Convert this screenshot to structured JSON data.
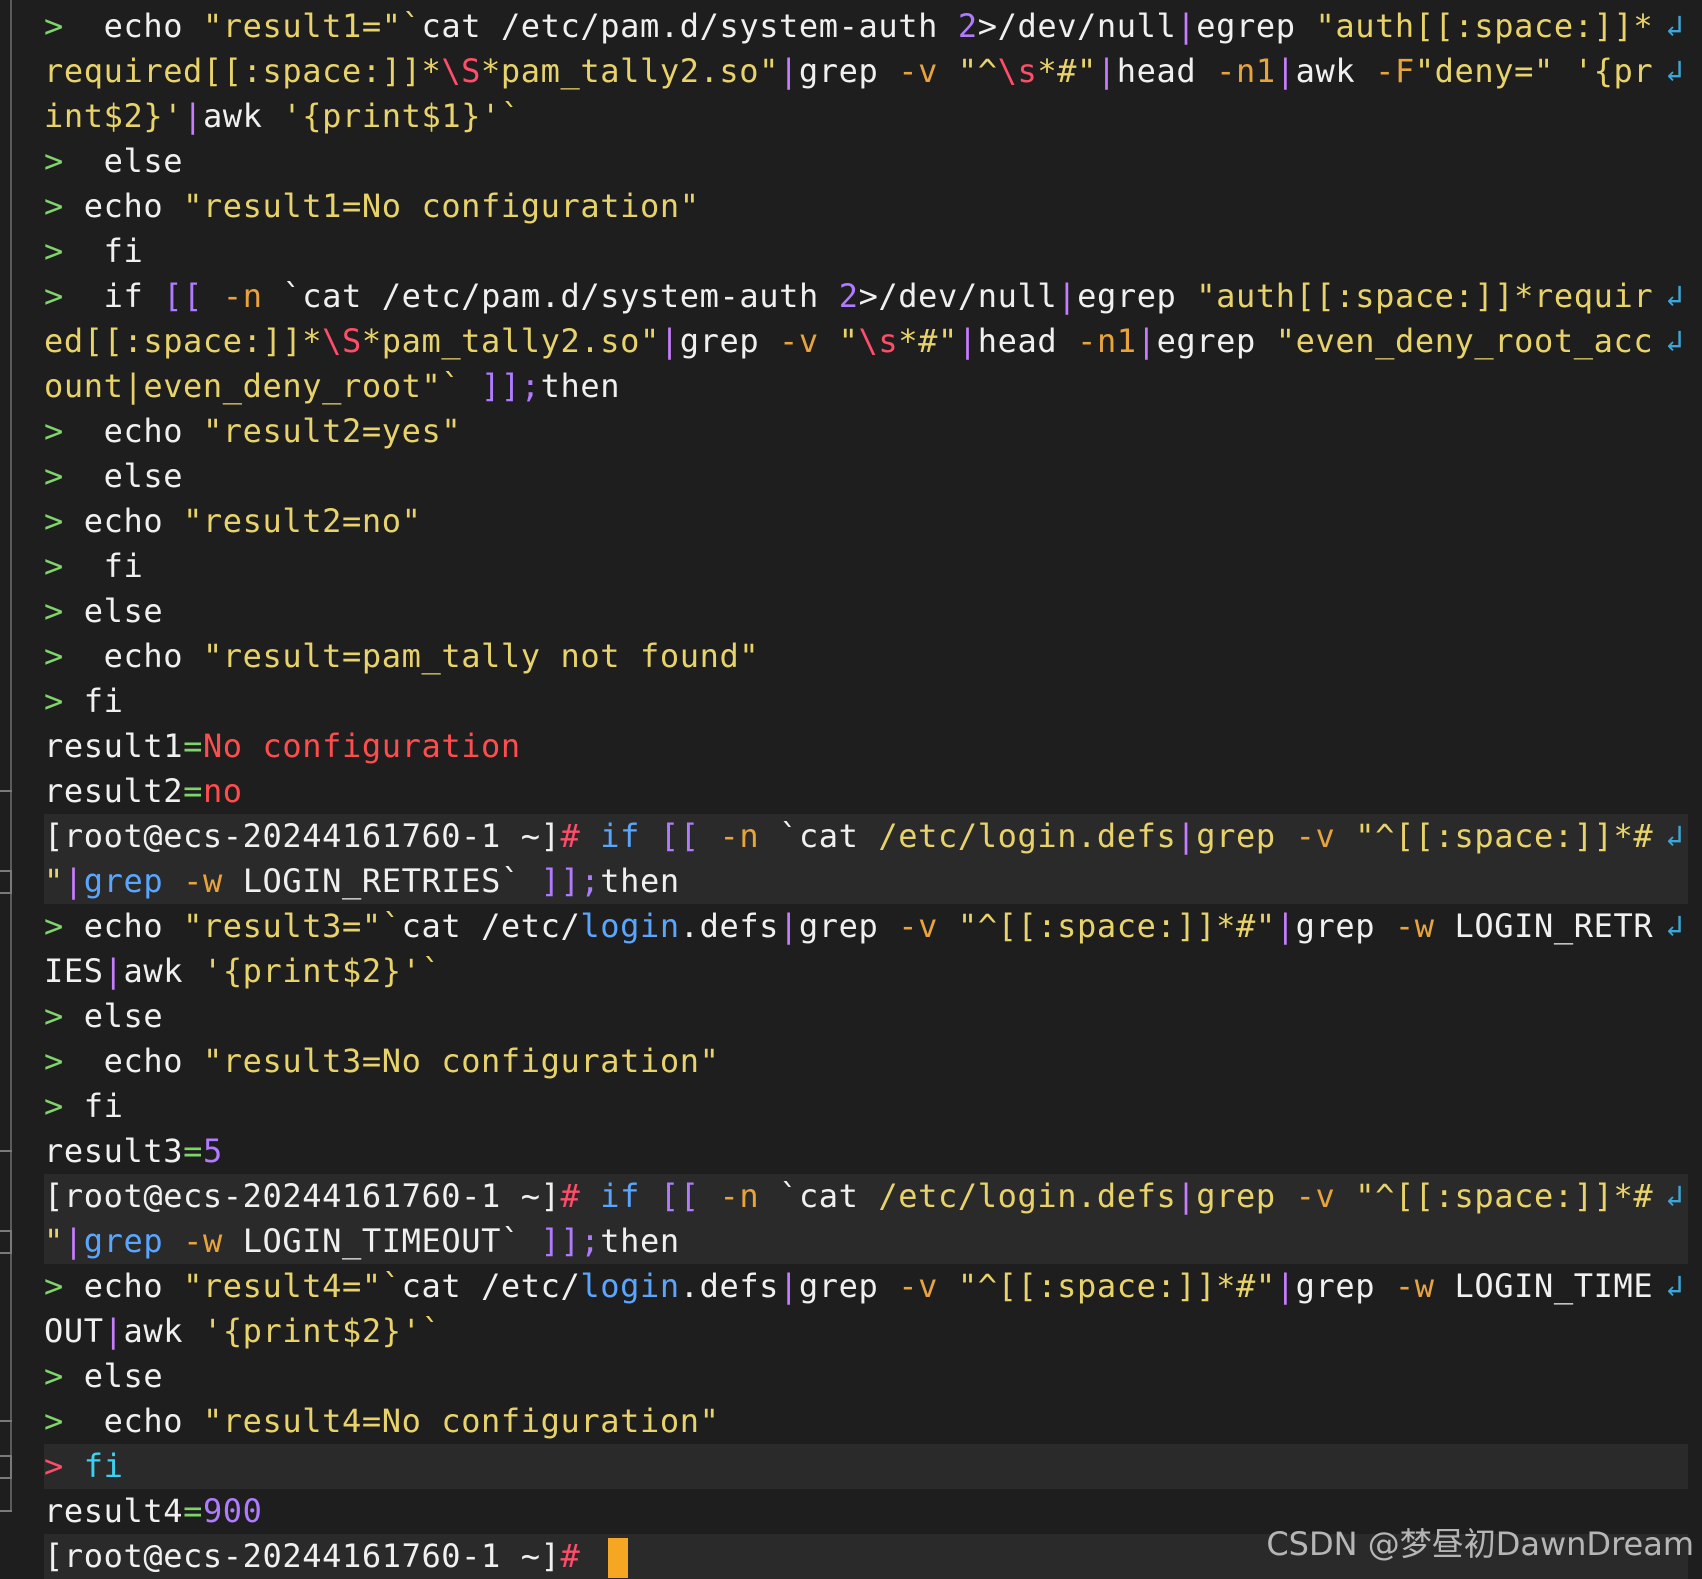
{
  "colors": {
    "background": "#1e1e1e",
    "prompt_gt": "#7fd46a",
    "string": "#e8d36a",
    "keyword": "#b07bff",
    "option": "#e8a33c",
    "error_red": "#ff4d4d",
    "cursor": "#f5a623"
  },
  "icons": {
    "wrap": "wrap-arrow-icon",
    "fold": "fold-marker-icon"
  },
  "prompt": "[root@ecs-20244161760-1 ~]#",
  "lines": [
    {
      "segments": [
        {
          "t": ">  ",
          "c": "pr"
        },
        {
          "t": "echo ",
          "c": "txt"
        },
        {
          "t": "\"result1=\"`",
          "c": "str"
        },
        {
          "t": "cat ",
          "c": "txt"
        },
        {
          "t": "/etc/pam.d/system-auth ",
          "c": "txt"
        },
        {
          "t": "2",
          "c": "num"
        },
        {
          "t": ">/dev/null",
          "c": "txt"
        },
        {
          "t": "|",
          "c": "pipe"
        },
        {
          "t": "egrep ",
          "c": "txt"
        },
        {
          "t": "\"auth[[:space:]]*",
          "c": "str"
        }
      ],
      "wrap": true
    },
    {
      "segments": [
        {
          "t": "required[[:space:]]*",
          "c": "str"
        },
        {
          "t": "\\S",
          "c": "esc"
        },
        {
          "t": "*pam_tally2.so\"",
          "c": "str"
        },
        {
          "t": "|",
          "c": "pipe"
        },
        {
          "t": "grep ",
          "c": "txt"
        },
        {
          "t": "-v ",
          "c": "opt"
        },
        {
          "t": "\"^",
          "c": "str"
        },
        {
          "t": "\\s",
          "c": "esc"
        },
        {
          "t": "*#\"",
          "c": "str"
        },
        {
          "t": "|",
          "c": "pipe"
        },
        {
          "t": "head ",
          "c": "txt"
        },
        {
          "t": "-n1",
          "c": "opt"
        },
        {
          "t": "|",
          "c": "pipe"
        },
        {
          "t": "awk ",
          "c": "txt"
        },
        {
          "t": "-F",
          "c": "opt"
        },
        {
          "t": "\"deny=\" ",
          "c": "str"
        },
        {
          "t": "'{pr",
          "c": "str"
        }
      ],
      "wrap": true
    },
    {
      "segments": [
        {
          "t": "int$2}'",
          "c": "str"
        },
        {
          "t": "|",
          "c": "pipe"
        },
        {
          "t": "awk ",
          "c": "txt"
        },
        {
          "t": "'{print$1}'`",
          "c": "str"
        }
      ]
    },
    {
      "segments": [
        {
          "t": ">  ",
          "c": "pr"
        },
        {
          "t": "else",
          "c": "txt"
        }
      ]
    },
    {
      "segments": [
        {
          "t": "> ",
          "c": "pr"
        },
        {
          "t": "echo ",
          "c": "txt"
        },
        {
          "t": "\"result1=No configuration\"",
          "c": "str"
        }
      ]
    },
    {
      "segments": [
        {
          "t": ">  ",
          "c": "pr"
        },
        {
          "t": "fi",
          "c": "txt"
        }
      ]
    },
    {
      "segments": [
        {
          "t": ">  ",
          "c": "pr"
        },
        {
          "t": "if ",
          "c": "txt"
        },
        {
          "t": "[[ ",
          "c": "kw"
        },
        {
          "t": "-n ",
          "c": "opt"
        },
        {
          "t": "`cat ",
          "c": "txt"
        },
        {
          "t": "/etc/pam.d/system-auth ",
          "c": "txt"
        },
        {
          "t": "2",
          "c": "num"
        },
        {
          "t": ">/dev/null",
          "c": "txt"
        },
        {
          "t": "|",
          "c": "pipe"
        },
        {
          "t": "egrep ",
          "c": "txt"
        },
        {
          "t": "\"auth[[:space:]]*requir",
          "c": "str"
        }
      ],
      "wrap": true
    },
    {
      "segments": [
        {
          "t": "ed[[:space:]]*",
          "c": "str"
        },
        {
          "t": "\\S",
          "c": "esc"
        },
        {
          "t": "*pam_tally2.so\"",
          "c": "str"
        },
        {
          "t": "|",
          "c": "pipe"
        },
        {
          "t": "grep ",
          "c": "txt"
        },
        {
          "t": "-v ",
          "c": "opt"
        },
        {
          "t": "\"",
          "c": "str"
        },
        {
          "t": "\\s",
          "c": "esc"
        },
        {
          "t": "*#\"",
          "c": "str"
        },
        {
          "t": "|",
          "c": "pipe"
        },
        {
          "t": "head ",
          "c": "txt"
        },
        {
          "t": "-n1",
          "c": "opt"
        },
        {
          "t": "|",
          "c": "pipe"
        },
        {
          "t": "egrep ",
          "c": "txt"
        },
        {
          "t": "\"even_deny_root_acc",
          "c": "str"
        }
      ],
      "wrap": true
    },
    {
      "segments": [
        {
          "t": "ount|even_deny_root\"` ",
          "c": "str"
        },
        {
          "t": "]];",
          "c": "kw"
        },
        {
          "t": "then",
          "c": "txt"
        }
      ]
    },
    {
      "segments": [
        {
          "t": ">  ",
          "c": "pr"
        },
        {
          "t": "echo ",
          "c": "txt"
        },
        {
          "t": "\"result2=yes\"",
          "c": "str"
        }
      ]
    },
    {
      "segments": [
        {
          "t": ">  ",
          "c": "pr"
        },
        {
          "t": "else",
          "c": "txt"
        }
      ]
    },
    {
      "segments": [
        {
          "t": "> ",
          "c": "pr"
        },
        {
          "t": "echo ",
          "c": "txt"
        },
        {
          "t": "\"result2=no\"",
          "c": "str"
        }
      ]
    },
    {
      "segments": [
        {
          "t": ">  ",
          "c": "pr"
        },
        {
          "t": "fi",
          "c": "txt"
        }
      ]
    },
    {
      "segments": [
        {
          "t": "> ",
          "c": "pr"
        },
        {
          "t": "else",
          "c": "txt"
        }
      ]
    },
    {
      "segments": [
        {
          "t": ">  ",
          "c": "pr"
        },
        {
          "t": "echo ",
          "c": "txt"
        },
        {
          "t": "\"result=pam_tally not found\"",
          "c": "str"
        }
      ]
    },
    {
      "segments": [
        {
          "t": "> ",
          "c": "pr"
        },
        {
          "t": "fi",
          "c": "txt"
        }
      ]
    },
    {
      "segments": [
        {
          "t": "result1",
          "c": "txt"
        },
        {
          "t": "=",
          "c": "pr"
        },
        {
          "t": "No configuration",
          "c": "red"
        }
      ]
    },
    {
      "segments": [
        {
          "t": "result2",
          "c": "txt"
        },
        {
          "t": "=",
          "c": "pr"
        },
        {
          "t": "no",
          "c": "red"
        }
      ]
    },
    {
      "hl": true,
      "segments": [
        {
          "t": "[root@ecs-20244161760-1 ~]",
          "c": "txt"
        },
        {
          "t": "# ",
          "c": "pr-red"
        },
        {
          "t": "if ",
          "c": "kw2"
        },
        {
          "t": "[[ ",
          "c": "kw"
        },
        {
          "t": "-n ",
          "c": "opt"
        },
        {
          "t": "`cat ",
          "c": "txt"
        },
        {
          "t": "/etc/login.defs",
          "c": "str"
        },
        {
          "t": "|",
          "c": "pipe"
        },
        {
          "t": "grep ",
          "c": "str"
        },
        {
          "t": "-v ",
          "c": "opt"
        },
        {
          "t": "\"^[[:space:]]*#",
          "c": "str"
        }
      ],
      "wrap": true
    },
    {
      "hl": true,
      "segments": [
        {
          "t": "\"",
          "c": "str"
        },
        {
          "t": "|",
          "c": "pipe"
        },
        {
          "t": "grep ",
          "c": "kw2"
        },
        {
          "t": "-w ",
          "c": "opt"
        },
        {
          "t": "LOGIN_RETRIES` ",
          "c": "txt"
        },
        {
          "t": "]];",
          "c": "kw"
        },
        {
          "t": "then",
          "c": "txt"
        }
      ]
    },
    {
      "segments": [
        {
          "t": "> ",
          "c": "pr"
        },
        {
          "t": "echo ",
          "c": "txt"
        },
        {
          "t": "\"result3=\"`",
          "c": "str"
        },
        {
          "t": "cat ",
          "c": "txt"
        },
        {
          "t": "/etc/",
          "c": "txt"
        },
        {
          "t": "login",
          "c": "kw2"
        },
        {
          "t": ".defs",
          "c": "txt"
        },
        {
          "t": "|",
          "c": "pipe"
        },
        {
          "t": "grep ",
          "c": "txt"
        },
        {
          "t": "-v ",
          "c": "opt"
        },
        {
          "t": "\"^[[:space:]]*#\"",
          "c": "str"
        },
        {
          "t": "|",
          "c": "pipe"
        },
        {
          "t": "grep ",
          "c": "txt"
        },
        {
          "t": "-w ",
          "c": "opt"
        },
        {
          "t": "LOGIN_RETR",
          "c": "txt"
        }
      ],
      "wrap": true
    },
    {
      "segments": [
        {
          "t": "IES",
          "c": "txt"
        },
        {
          "t": "|",
          "c": "pipe"
        },
        {
          "t": "awk ",
          "c": "txt"
        },
        {
          "t": "'{print$2}'`",
          "c": "str"
        }
      ]
    },
    {
      "segments": [
        {
          "t": "> ",
          "c": "pr"
        },
        {
          "t": "else",
          "c": "txt"
        }
      ]
    },
    {
      "segments": [
        {
          "t": ">  ",
          "c": "pr"
        },
        {
          "t": "echo ",
          "c": "txt"
        },
        {
          "t": "\"result3=No configuration\"",
          "c": "str"
        }
      ]
    },
    {
      "segments": [
        {
          "t": "> ",
          "c": "pr"
        },
        {
          "t": "fi",
          "c": "txt"
        }
      ]
    },
    {
      "segments": [
        {
          "t": "result3",
          "c": "txt"
        },
        {
          "t": "=",
          "c": "pr"
        },
        {
          "t": "5",
          "c": "num"
        }
      ]
    },
    {
      "hl": true,
      "segments": [
        {
          "t": "[root@ecs-20244161760-1 ~]",
          "c": "txt"
        },
        {
          "t": "# ",
          "c": "pr-red"
        },
        {
          "t": "if ",
          "c": "kw2"
        },
        {
          "t": "[[ ",
          "c": "kw"
        },
        {
          "t": "-n ",
          "c": "opt"
        },
        {
          "t": "`cat ",
          "c": "txt"
        },
        {
          "t": "/etc/login.defs",
          "c": "str"
        },
        {
          "t": "|",
          "c": "pipe"
        },
        {
          "t": "grep ",
          "c": "str"
        },
        {
          "t": "-v ",
          "c": "opt"
        },
        {
          "t": "\"^[[:space:]]*#",
          "c": "str"
        }
      ],
      "wrap": true
    },
    {
      "hl": true,
      "segments": [
        {
          "t": "\"",
          "c": "str"
        },
        {
          "t": "|",
          "c": "pipe"
        },
        {
          "t": "grep ",
          "c": "kw2"
        },
        {
          "t": "-w ",
          "c": "opt"
        },
        {
          "t": "LOGIN_TIMEOUT` ",
          "c": "txt"
        },
        {
          "t": "]];",
          "c": "kw"
        },
        {
          "t": "then",
          "c": "txt"
        }
      ]
    },
    {
      "segments": [
        {
          "t": "> ",
          "c": "pr"
        },
        {
          "t": "echo ",
          "c": "txt"
        },
        {
          "t": "\"result4=\"`",
          "c": "str"
        },
        {
          "t": "cat ",
          "c": "txt"
        },
        {
          "t": "/etc/",
          "c": "txt"
        },
        {
          "t": "login",
          "c": "kw2"
        },
        {
          "t": ".defs",
          "c": "txt"
        },
        {
          "t": "|",
          "c": "pipe"
        },
        {
          "t": "grep ",
          "c": "txt"
        },
        {
          "t": "-v ",
          "c": "opt"
        },
        {
          "t": "\"^[[:space:]]*#\"",
          "c": "str"
        },
        {
          "t": "|",
          "c": "pipe"
        },
        {
          "t": "grep ",
          "c": "txt"
        },
        {
          "t": "-w ",
          "c": "opt"
        },
        {
          "t": "LOGIN_TIME",
          "c": "txt"
        }
      ],
      "wrap": true
    },
    {
      "segments": [
        {
          "t": "OUT",
          "c": "txt"
        },
        {
          "t": "|",
          "c": "pipe"
        },
        {
          "t": "awk ",
          "c": "txt"
        },
        {
          "t": "'{print$2}'`",
          "c": "str"
        }
      ]
    },
    {
      "segments": [
        {
          "t": "> ",
          "c": "pr"
        },
        {
          "t": "else",
          "c": "txt"
        }
      ]
    },
    {
      "segments": [
        {
          "t": ">  ",
          "c": "pr"
        },
        {
          "t": "echo ",
          "c": "txt"
        },
        {
          "t": "\"result4=No configuration\"",
          "c": "str"
        }
      ]
    },
    {
      "hl": true,
      "segments": [
        {
          "t": "> ",
          "c": "pr-red"
        },
        {
          "t": "fi",
          "c": "cyan"
        }
      ]
    },
    {
      "segments": [
        {
          "t": "result4",
          "c": "txt"
        },
        {
          "t": "=",
          "c": "pr"
        },
        {
          "t": "900",
          "c": "num"
        }
      ]
    },
    {
      "hl": true,
      "cursor": true,
      "segments": [
        {
          "t": "[root@ecs-20244161760-1 ~]",
          "c": "txt"
        },
        {
          "t": "# ",
          "c": "pr-red"
        }
      ]
    }
  ],
  "watermark": "CSDN @梦昼初DawnDream"
}
